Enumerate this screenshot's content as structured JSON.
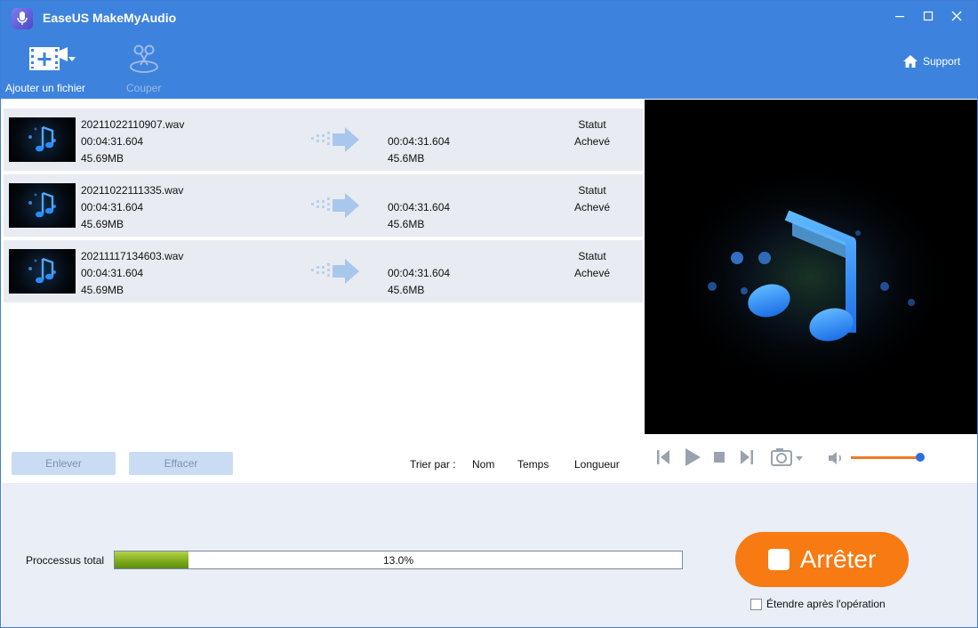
{
  "window": {
    "title": "EaseUS MakeMyAudio"
  },
  "toolbar": {
    "add_file_label": "Ajouter un fichier",
    "cut_label": "Couper",
    "support_label": "Support"
  },
  "files": [
    {
      "name": "20211022110907.wav",
      "duration": "00:04:31.604",
      "size": "45.69MB",
      "out_duration": "00:04:31.604",
      "out_size": "45.6MB",
      "status_label": "Statut",
      "status": "Achevé"
    },
    {
      "name": "20211022111335.wav",
      "duration": "00:04:31.604",
      "size": "45.69MB",
      "out_duration": "00:04:31.604",
      "out_size": "45.6MB",
      "status_label": "Statut",
      "status": "Achevé"
    },
    {
      "name": "20211117134603.wav",
      "duration": "00:04:31.604",
      "size": "45.69MB",
      "out_duration": "00:04:31.604",
      "out_size": "45.6MB",
      "status_label": "Statut",
      "status": "Achevé"
    }
  ],
  "list_actions": {
    "remove_label": "Enlever",
    "clear_label": "Effacer"
  },
  "sort": {
    "label": "Trier par :",
    "by_name": "Nom",
    "by_time": "Temps",
    "by_length": "Longueur"
  },
  "player": {
    "volume_fraction": 0.95
  },
  "progress": {
    "label": "Proccessus total",
    "percent": 13.0,
    "text": "13.0%"
  },
  "stop_button": {
    "label": "Arrêter"
  },
  "extend_option": {
    "label": "Étendre après l'opération",
    "checked": false
  },
  "colors": {
    "brand_blue": "#3d83dd",
    "stop_orange": "#f77a12",
    "progress_green": "#7aa819",
    "volume_orange": "#f07a23"
  },
  "icons": [
    "app-logo-icon",
    "minimize-icon",
    "maximize-icon",
    "close-icon",
    "add-file-icon",
    "dropdown-arrow-icon",
    "scissors-icon",
    "home-icon",
    "music-note-icon",
    "convert-arrow-icon",
    "previous-icon",
    "play-icon",
    "stop-icon",
    "next-icon",
    "camera-icon",
    "speaker-icon"
  ]
}
